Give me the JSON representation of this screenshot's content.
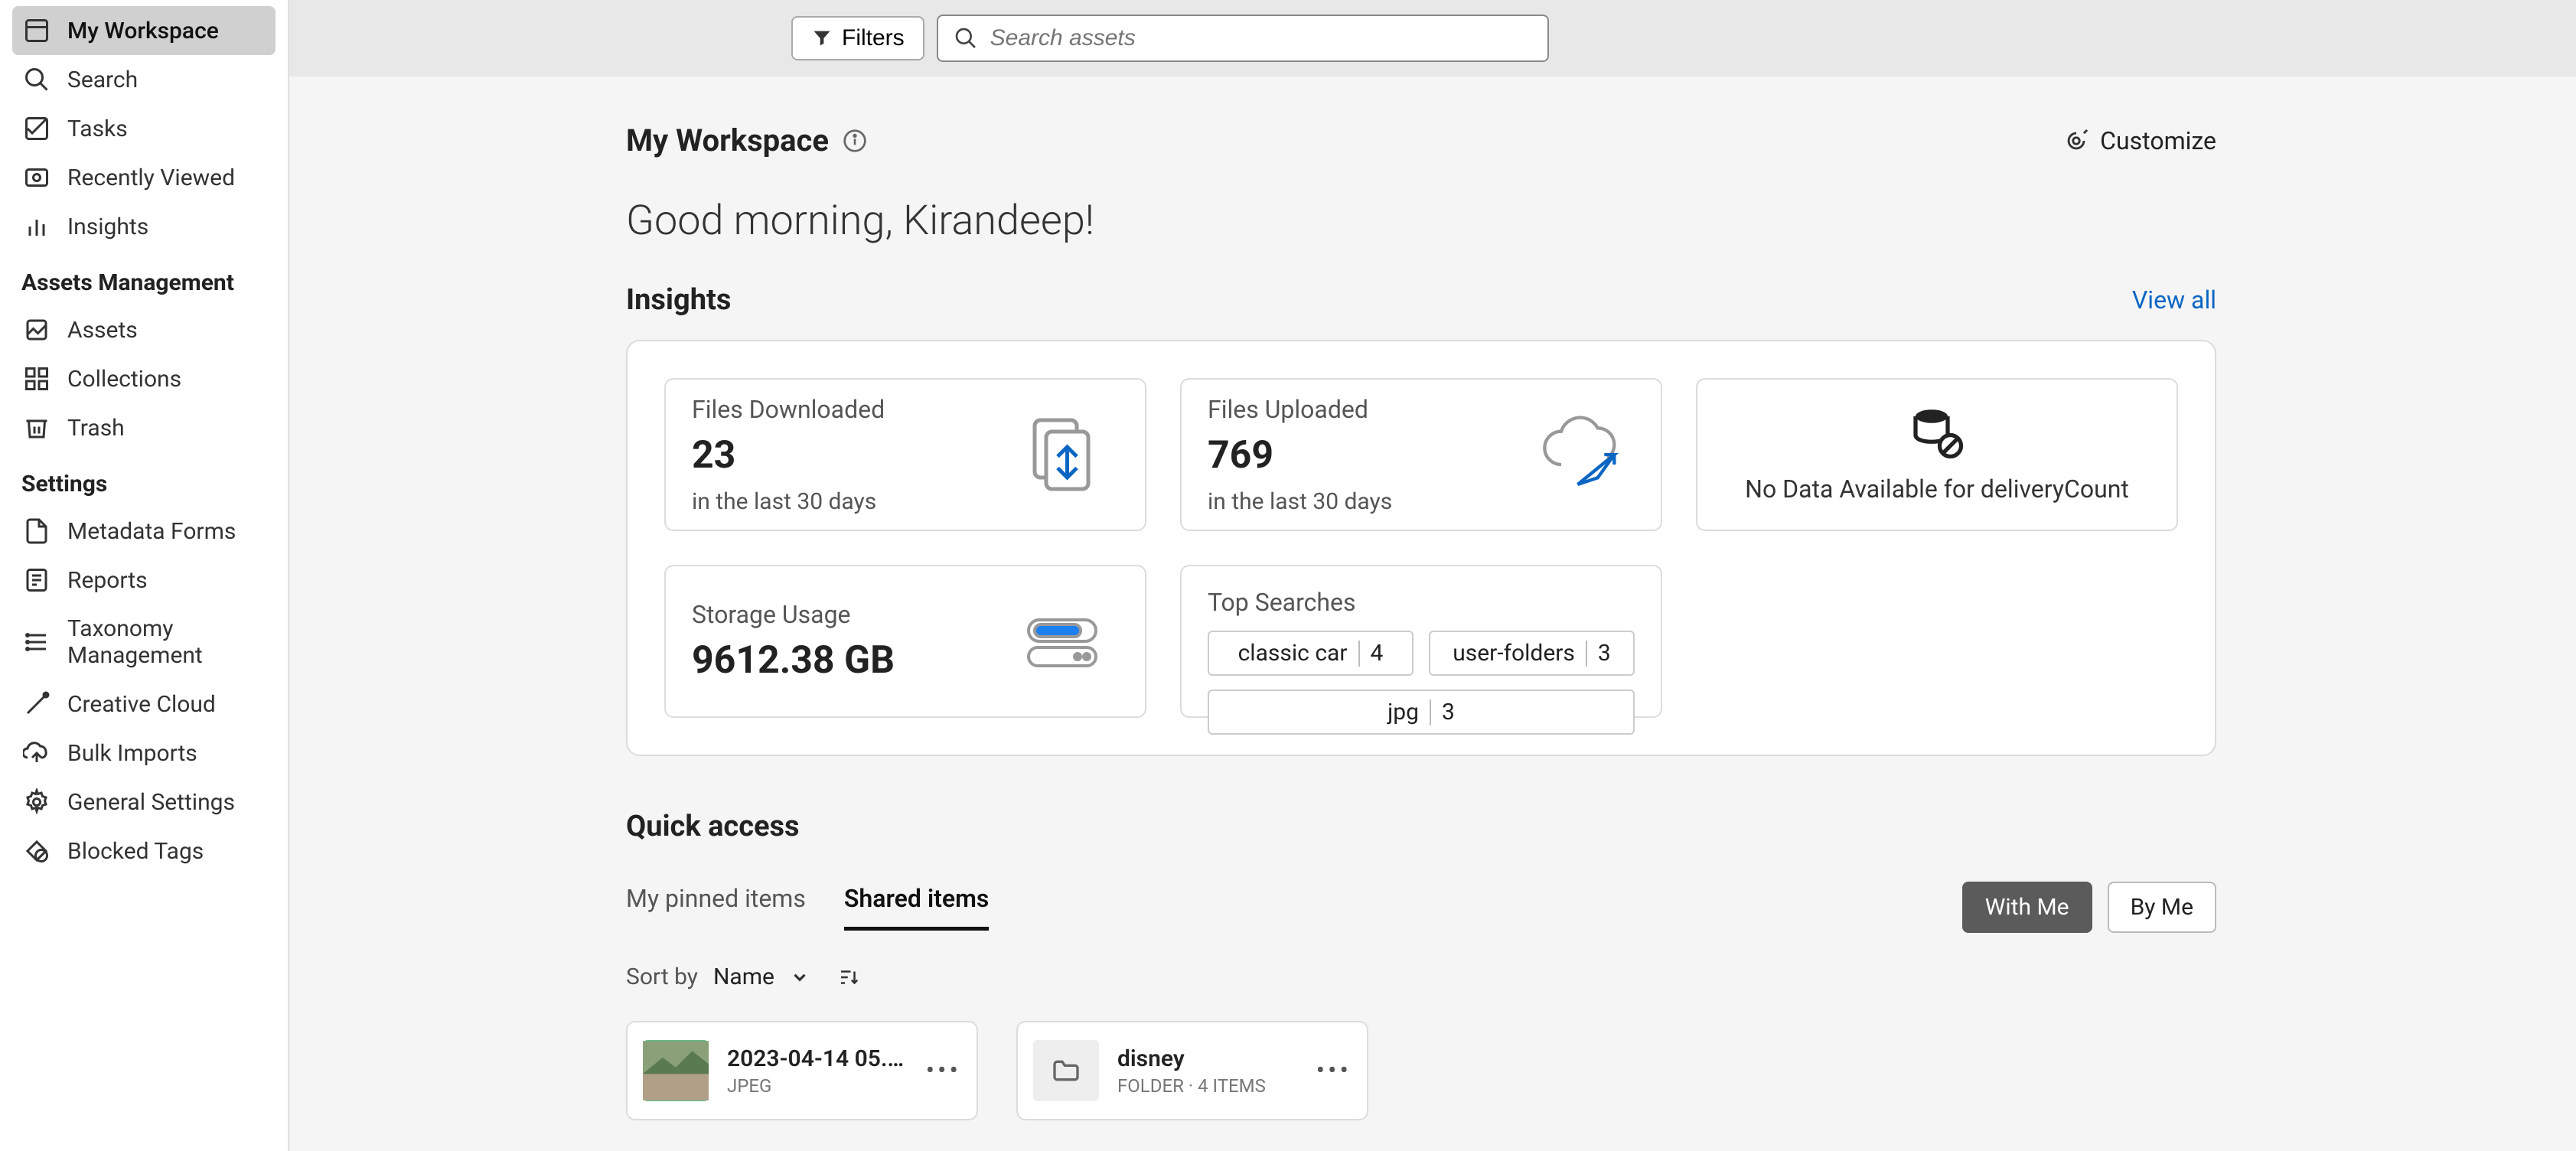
{
  "sidebar": {
    "top": [
      {
        "label": "My Workspace",
        "icon": "workspace-icon",
        "active": true
      },
      {
        "label": "Search",
        "icon": "search-icon"
      },
      {
        "label": "Tasks",
        "icon": "tasks-icon"
      },
      {
        "label": "Recently Viewed",
        "icon": "recent-icon"
      },
      {
        "label": "Insights",
        "icon": "insights-icon"
      }
    ],
    "assets_header": "Assets Management",
    "assets": [
      {
        "label": "Assets",
        "icon": "assets-icon"
      },
      {
        "label": "Collections",
        "icon": "collections-icon"
      },
      {
        "label": "Trash",
        "icon": "trash-icon"
      }
    ],
    "settings_header": "Settings",
    "settings": [
      {
        "label": "Metadata Forms",
        "icon": "metadata-icon"
      },
      {
        "label": "Reports",
        "icon": "reports-icon"
      },
      {
        "label": "Taxonomy Management",
        "icon": "taxonomy-icon"
      },
      {
        "label": "Creative Cloud",
        "icon": "creative-icon"
      },
      {
        "label": "Bulk Imports",
        "icon": "bulkimport-icon"
      },
      {
        "label": "General Settings",
        "icon": "gear-icon"
      },
      {
        "label": "Blocked Tags",
        "icon": "blocked-icon"
      }
    ]
  },
  "topbar": {
    "filters": "Filters",
    "search_placeholder": "Search assets"
  },
  "page": {
    "title": "My Workspace",
    "customize": "Customize",
    "greeting": "Good morning, Kirandeep!"
  },
  "insights": {
    "title": "Insights",
    "view_all": "View all",
    "cards": {
      "downloaded": {
        "label": "Files Downloaded",
        "value": "23",
        "sub": "in the last 30 days"
      },
      "uploaded": {
        "label": "Files Uploaded",
        "value": "769",
        "sub": "in the last 30 days"
      },
      "nodata": {
        "label": "No Data Available for deliveryCount"
      },
      "storage": {
        "label": "Storage Usage",
        "value": "9612.38 GB"
      },
      "topsearch": {
        "label": "Top Searches",
        "chips": [
          {
            "term": "classic car",
            "count": "4"
          },
          {
            "term": "user-folders",
            "count": "3"
          },
          {
            "term": "jpg",
            "count": "3"
          }
        ]
      }
    }
  },
  "quick": {
    "title": "Quick access",
    "tabs": [
      "My pinned items",
      "Shared items"
    ],
    "active_tab": 1,
    "toggles": [
      "With Me",
      "By Me"
    ],
    "active_toggle": 0,
    "sort_label": "Sort by",
    "sort_value": "Name",
    "items": [
      {
        "title": "2023-04-14 05.1…",
        "sub": "JPEG",
        "type": "image"
      },
      {
        "title": "disney",
        "sub": "FOLDER · 4 ITEMS",
        "type": "folder"
      }
    ]
  }
}
